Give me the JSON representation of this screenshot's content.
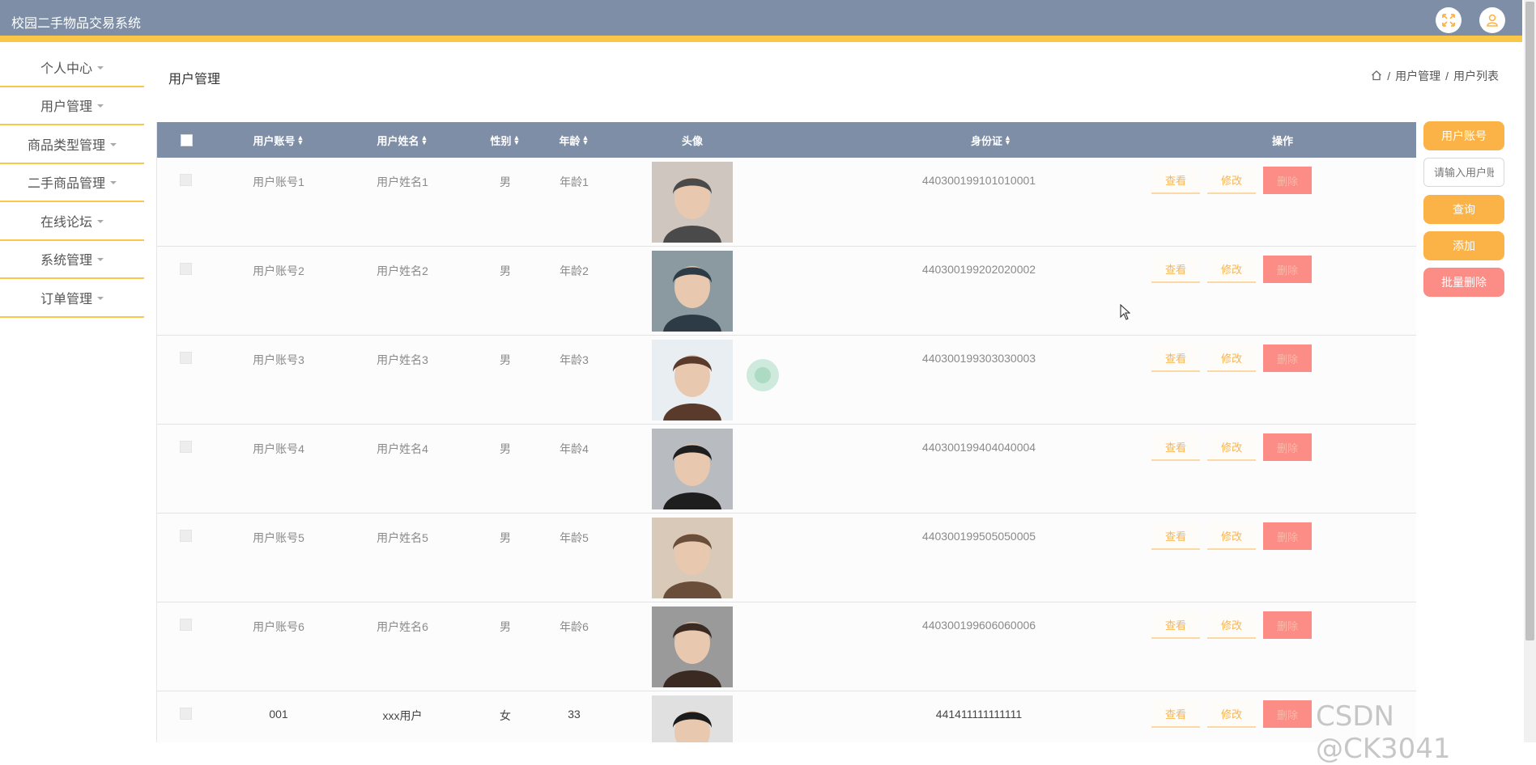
{
  "app": {
    "title": "校园二手物品交易系统"
  },
  "sidebar": {
    "items": [
      {
        "label": "个人中心"
      },
      {
        "label": "用户管理"
      },
      {
        "label": "商品类型管理"
      },
      {
        "label": "二手商品管理"
      },
      {
        "label": "在线论坛"
      },
      {
        "label": "系统管理"
      },
      {
        "label": "订单管理"
      }
    ]
  },
  "page": {
    "title": "用户管理",
    "breadcrumb": [
      "用户管理",
      "用户列表"
    ],
    "breadcrumb_sep": "/"
  },
  "table": {
    "columns": {
      "account": "用户账号",
      "name": "用户姓名",
      "gender": "性别",
      "age": "年龄",
      "avatar": "头像",
      "idcard": "身份证",
      "actions": "操作"
    },
    "rows": [
      {
        "account": "用户账号1",
        "name": "用户姓名1",
        "gender": "男",
        "age": "年龄1",
        "idcard": "440300199101010001"
      },
      {
        "account": "用户账号2",
        "name": "用户姓名2",
        "gender": "男",
        "age": "年龄2",
        "idcard": "440300199202020002"
      },
      {
        "account": "用户账号3",
        "name": "用户姓名3",
        "gender": "男",
        "age": "年龄3",
        "idcard": "440300199303030003"
      },
      {
        "account": "用户账号4",
        "name": "用户姓名4",
        "gender": "男",
        "age": "年龄4",
        "idcard": "440300199404040004"
      },
      {
        "account": "用户账号5",
        "name": "用户姓名5",
        "gender": "男",
        "age": "年龄5",
        "idcard": "440300199505050005"
      },
      {
        "account": "用户账号6",
        "name": "用户姓名6",
        "gender": "男",
        "age": "年龄6",
        "idcard": "440300199606060006"
      },
      {
        "account": "001",
        "name": "xxx用户",
        "gender": "女",
        "age": "33",
        "idcard": "441411111111111"
      }
    ],
    "action_labels": {
      "view": "查看",
      "edit": "修改",
      "delete": "删除"
    }
  },
  "rightpanel": {
    "field_label": "用户账号",
    "search_placeholder": "请输入用户账号",
    "query": "查询",
    "add": "添加",
    "batch_delete": "批量删除"
  },
  "watermark": "CSDN @CK3041",
  "colors": {
    "header": "#7e8ea6",
    "accent": "#fbc748",
    "button": "#fbb347",
    "danger": "#fb8c86"
  }
}
